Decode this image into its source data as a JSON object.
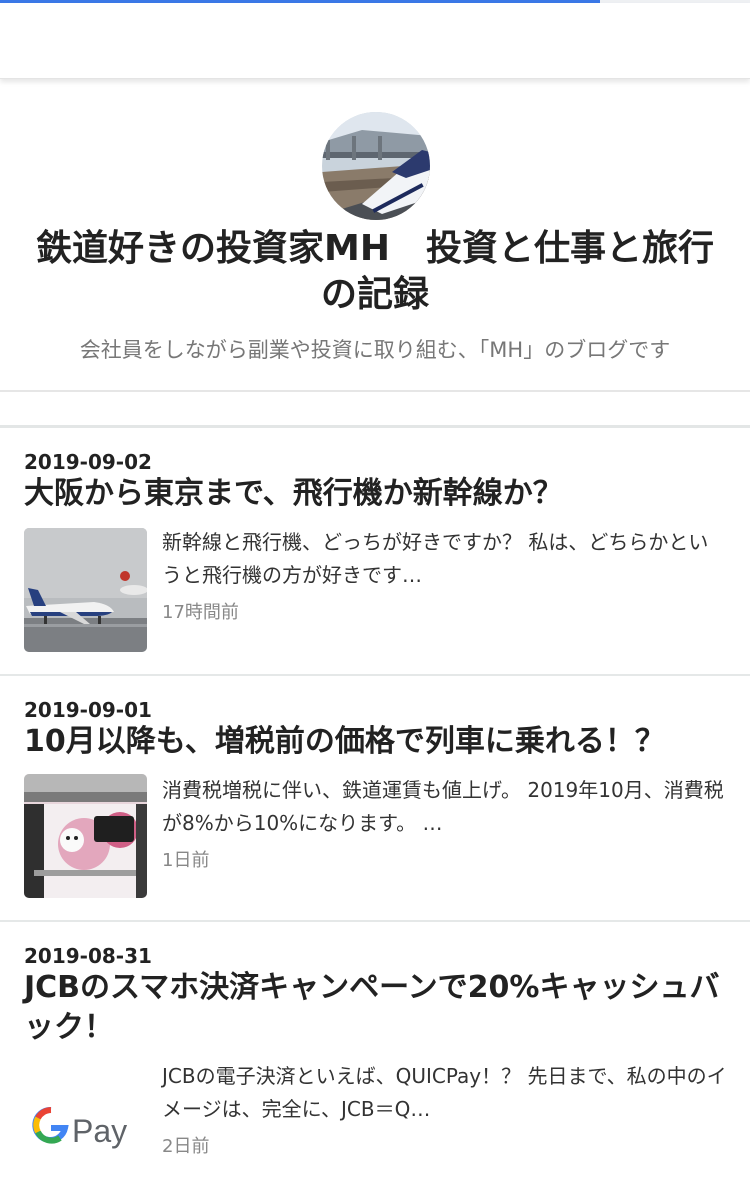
{
  "progress": {
    "fraction": 0.8,
    "color": "#3b78e7"
  },
  "blog": {
    "title": "鉄道好きの投資家MH　投資と仕事と旅行の記録",
    "description": "会社員をしながら副業や投資に取り組む、「MH」のブログです"
  },
  "entries": [
    {
      "date": "2019-09-02",
      "title": "大阪から東京まで、飛行機か新幹線か？",
      "excerpt": "新幹線と飛行機、どっちが好きですか？ 私は、どちらかというと飛行機の方が好きです…",
      "ago": "17時間前"
    },
    {
      "date": "2019-09-01",
      "title": "10月以降も、増税前の価格で列車に乗れる！？",
      "excerpt": "消費税増税に伴い、鉄道運賃も値上げ。 2019年10月、消費税が8%から10%になります。 …",
      "ago": "1日前"
    },
    {
      "date": "2019-08-31",
      "title": "JCBのスマホ決済キャンペーンで20%キャッシュバック！",
      "excerpt": "JCBの電子決済といえば、QUICPay！？ 先日まで、私の中のイメージは、完全に、JCB＝Q…",
      "ago": "2日前",
      "thumb_text": "Pay"
    }
  ]
}
